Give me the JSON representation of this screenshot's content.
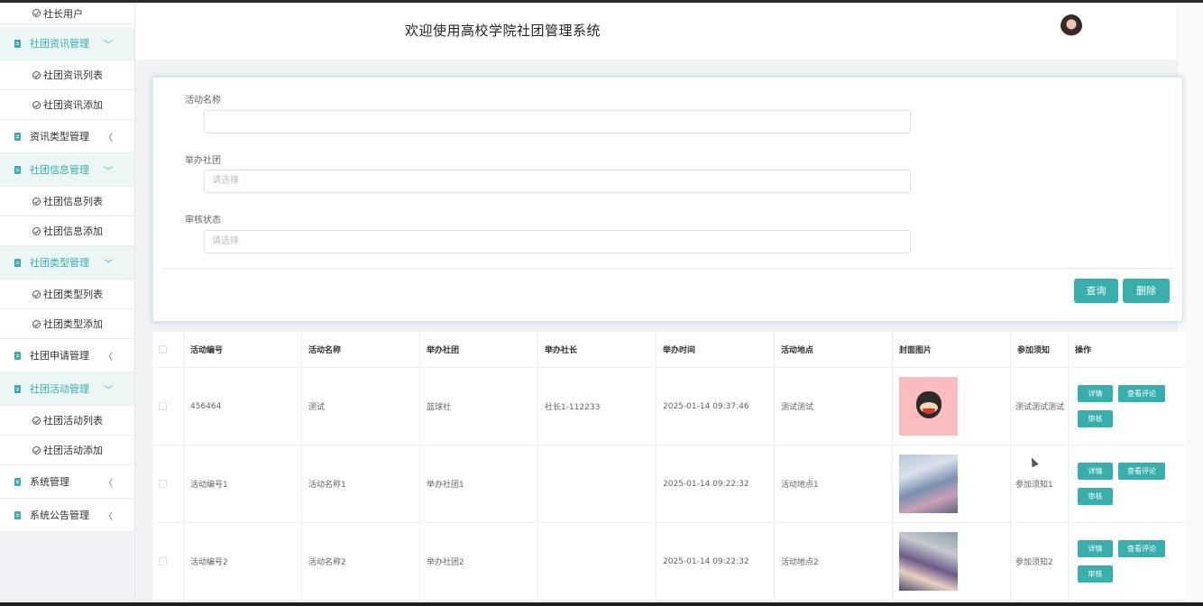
{
  "header": {
    "title": "欢迎使用高校学院社团管理系统"
  },
  "sidebar": {
    "items": [
      {
        "label": "社长用户",
        "type": "child"
      },
      {
        "label": "社团资讯管理",
        "type": "parent",
        "active": true,
        "chevron": "chevron-down-icon"
      },
      {
        "label": "社团资讯列表",
        "type": "child"
      },
      {
        "label": "社团资讯添加",
        "type": "child"
      },
      {
        "label": "资讯类型管理",
        "type": "parent",
        "active": false,
        "chevron": "chevron-left-icon"
      },
      {
        "label": "社团信息管理",
        "type": "parent",
        "active": true,
        "chevron": "chevron-down-icon"
      },
      {
        "label": "社团信息列表",
        "type": "child"
      },
      {
        "label": "社团信息添加",
        "type": "child"
      },
      {
        "label": "社团类型管理",
        "type": "parent",
        "active": true,
        "chevron": "chevron-down-icon"
      },
      {
        "label": "社团类型列表",
        "type": "child"
      },
      {
        "label": "社团类型添加",
        "type": "child"
      },
      {
        "label": "社团申请管理",
        "type": "parent",
        "active": false,
        "chevron": "chevron-left-icon"
      },
      {
        "label": "社团活动管理",
        "type": "parent",
        "active": true,
        "chevron": "chevron-down-icon"
      },
      {
        "label": "社团活动列表",
        "type": "child"
      },
      {
        "label": "社团活动添加",
        "type": "child"
      },
      {
        "label": "系统管理",
        "type": "parent",
        "active": false,
        "chevron": "chevron-left-icon"
      },
      {
        "label": "系统公告管理",
        "type": "parent",
        "active": false,
        "chevron": "chevron-left-icon"
      }
    ]
  },
  "search": {
    "activity_name_label": "活动名称",
    "activity_name_value": "",
    "club_label": "举办社团",
    "club_placeholder": "请选择",
    "status_label": "审核状态",
    "status_placeholder": "请选择",
    "query_button": "查询",
    "delete_button": "删除"
  },
  "table": {
    "columns": [
      "活动编号",
      "活动名称",
      "举办社团",
      "举办社长",
      "举办时间",
      "活动地点",
      "封面图片",
      "参加须知",
      "操作"
    ],
    "rows": [
      {
        "id": "456464",
        "name": "测试",
        "club": "篮球社",
        "leader": "社长1-112233",
        "time": "2025-01-14 09:37:46",
        "location": "测试测试",
        "cover": "monkey-cartoon-image",
        "notice": "测试测试测试"
      },
      {
        "id": "活动编号1",
        "name": "活动名称1",
        "club": "举办社团1",
        "leader": "",
        "time": "2025-01-14 09:22:32",
        "location": "活动地点1",
        "cover": "campus-event-photo",
        "notice": "参加须知1"
      },
      {
        "id": "活动编号2",
        "name": "活动名称2",
        "club": "举办社团2",
        "leader": "",
        "time": "2025-01-14 09:22:32",
        "location": "活动地点2",
        "cover": "classroom-photo",
        "notice": "参加须知2"
      }
    ],
    "actions": {
      "detail": "详情",
      "comments": "查看评论",
      "review": "审核"
    }
  },
  "colors": {
    "accent": "#38afad",
    "active_menu_bg": "#ebf6f5"
  }
}
